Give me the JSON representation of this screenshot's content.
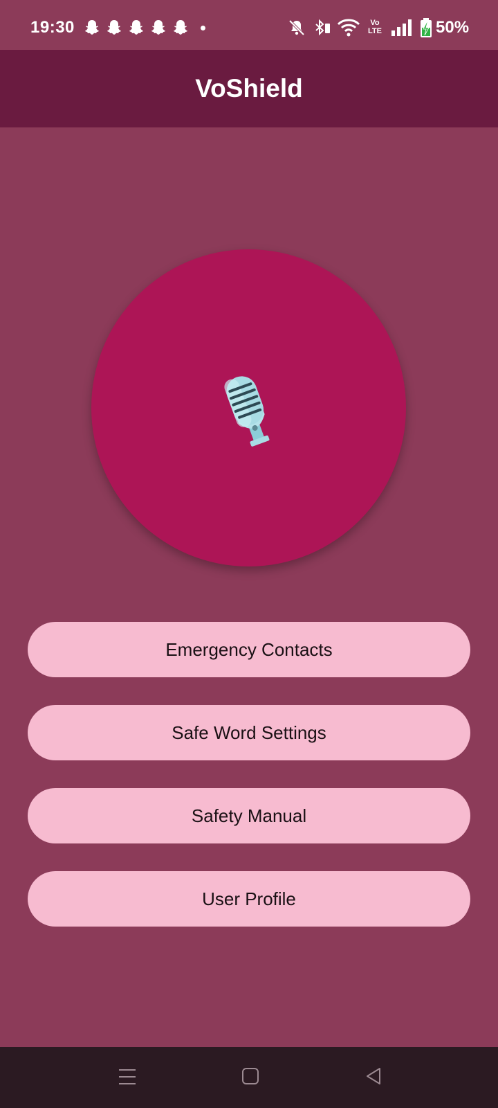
{
  "status_bar": {
    "time": "19:30",
    "notification_icons": [
      "snapchat-ghost-icon",
      "snapchat-ghost-icon",
      "snapchat-ghost-icon",
      "snapchat-ghost-icon",
      "snapchat-ghost-icon",
      "dot-icon"
    ],
    "system_icons": [
      "mute-bell-icon",
      "bluetooth-icon",
      "wifi-icon",
      "volte-icon",
      "signal-icon",
      "battery-charging-icon"
    ],
    "volte_label_top": "Vo",
    "volte_label_bottom": "LTE",
    "battery": "50%"
  },
  "app_bar": {
    "title": "VoShield"
  },
  "main": {
    "mic_button_icon": "microphone-icon",
    "menu": [
      {
        "label": "Emergency Contacts"
      },
      {
        "label": "Safe Word Settings"
      },
      {
        "label": "Safety Manual"
      },
      {
        "label": "User Profile"
      }
    ]
  },
  "nav_bar": {
    "icons": [
      "menu-icon",
      "home-icon",
      "back-icon"
    ]
  },
  "colors": {
    "background": "#8c3b59",
    "app_bar": "#6a1b40",
    "mic_circle": "#ad1556",
    "button": "#f7bbd0",
    "nav_bar": "#2b1a22"
  }
}
